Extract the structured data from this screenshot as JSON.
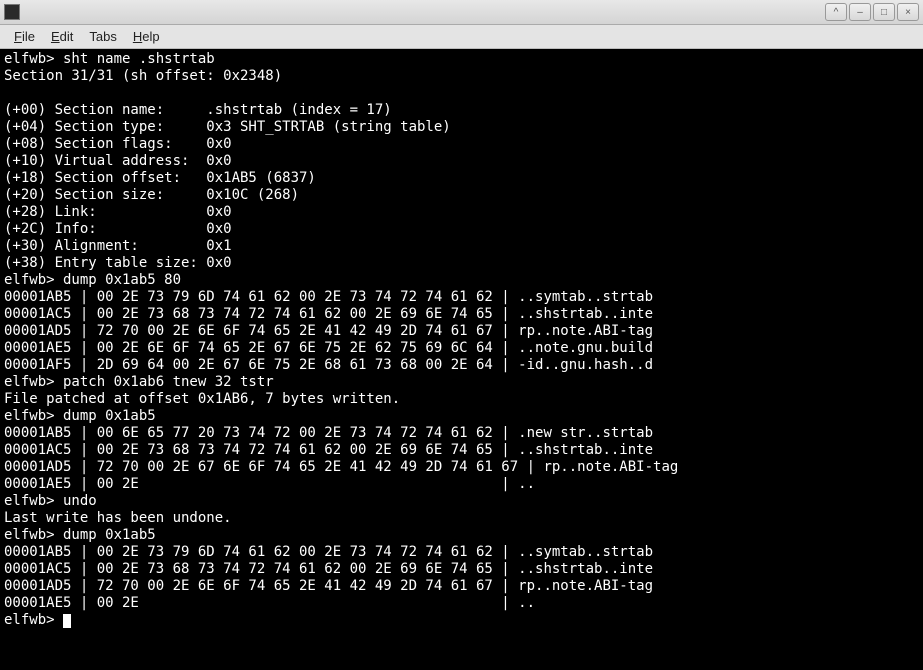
{
  "menu": {
    "file": "File",
    "edit": "Edit",
    "tabs": "Tabs",
    "help": "Help"
  },
  "window_controls": {
    "up": "^",
    "min": "–",
    "max": "□",
    "close": "×"
  },
  "terminal_lines": [
    "elfwb> sht name .shstrtab",
    "Section 31/31 (sh offset: 0x2348)",
    "",
    "(+00) Section name:     .shstrtab (index = 17)",
    "(+04) Section type:     0x3 SHT_STRTAB (string table)",
    "(+08) Section flags:    0x0",
    "(+10) Virtual address:  0x0",
    "(+18) Section offset:   0x1AB5 (6837)",
    "(+20) Section size:     0x10C (268)",
    "(+28) Link:             0x0",
    "(+2C) Info:             0x0",
    "(+30) Alignment:        0x1",
    "(+38) Entry table size: 0x0",
    "elfwb> dump 0x1ab5 80",
    "00001AB5 | 00 2E 73 79 6D 74 61 62 00 2E 73 74 72 74 61 62 | ..symtab..strtab",
    "00001AC5 | 00 2E 73 68 73 74 72 74 61 62 00 2E 69 6E 74 65 | ..shstrtab..inte",
    "00001AD5 | 72 70 00 2E 6E 6F 74 65 2E 41 42 49 2D 74 61 67 | rp..note.ABI-tag",
    "00001AE5 | 00 2E 6E 6F 74 65 2E 67 6E 75 2E 62 75 69 6C 64 | ..note.gnu.build",
    "00001AF5 | 2D 69 64 00 2E 67 6E 75 2E 68 61 73 68 00 2E 64 | -id..gnu.hash..d",
    "elfwb> patch 0x1ab6 tnew 32 tstr",
    "File patched at offset 0x1AB6, 7 bytes written.",
    "elfwb> dump 0x1ab5",
    "00001AB5 | 00 6E 65 77 20 73 74 72 00 2E 73 74 72 74 61 62 | .new str..strtab",
    "00001AC5 | 00 2E 73 68 73 74 72 74 61 62 00 2E 69 6E 74 65 | ..shstrtab..inte",
    "00001AD5 | 72 70 00 2E 67 6E 6F 74 65 2E 41 42 49 2D 74 61 67 | rp..note.ABI-tag",
    "00001AE5 | 00 2E                                           | ..",
    "elfwb> undo",
    "Last write has been undone.",
    "elfwb> dump 0x1ab5",
    "00001AB5 | 00 2E 73 79 6D 74 61 62 00 2E 73 74 72 74 61 62 | ..symtab..strtab",
    "00001AC5 | 00 2E 73 68 73 74 72 74 61 62 00 2E 69 6E 74 65 | ..shstrtab..inte",
    "00001AD5 | 72 70 00 2E 6E 6F 74 65 2E 41 42 49 2D 74 61 67 | rp..note.ABI-tag",
    "00001AE5 | 00 2E                                           | ..",
    "elfwb> "
  ]
}
